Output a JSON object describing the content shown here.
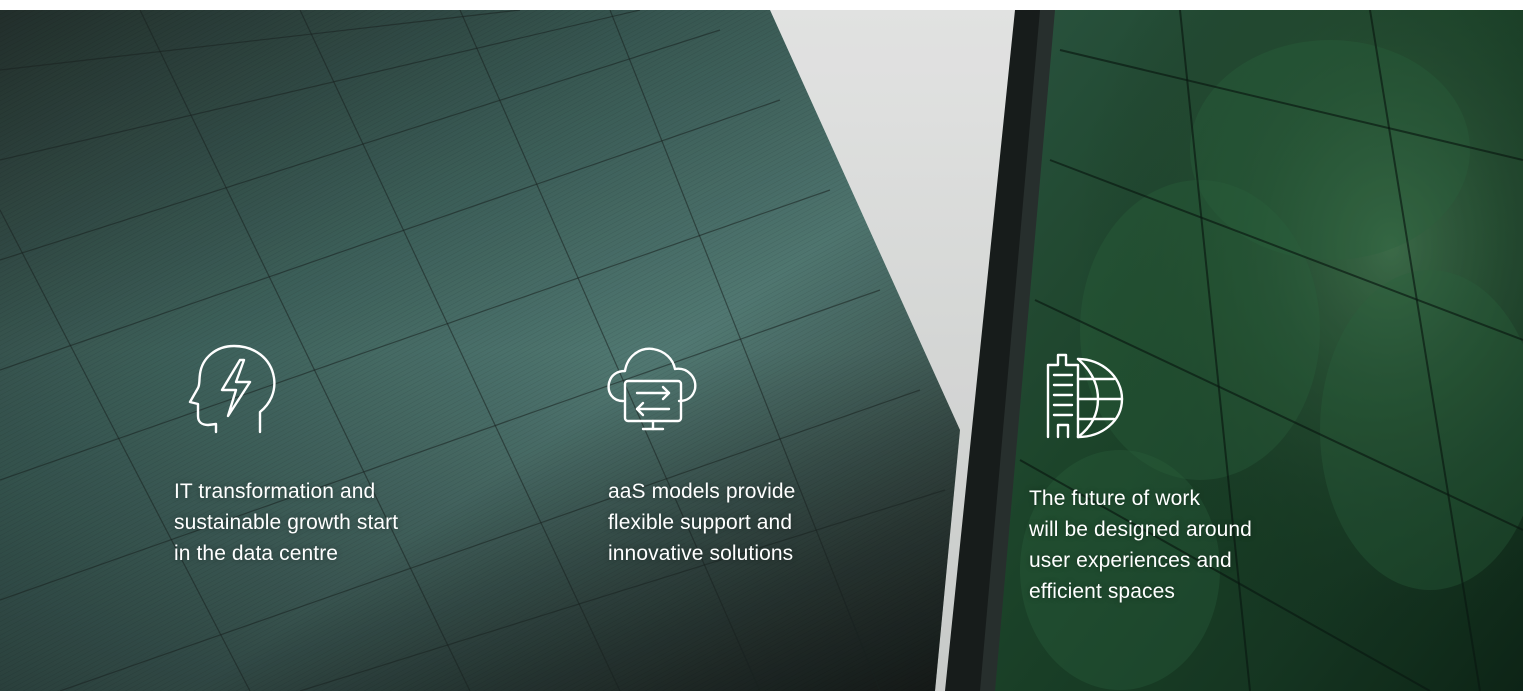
{
  "features": [
    {
      "icon": "head-lightning-icon",
      "lines": [
        "IT transformation and",
        "sustainable growth start",
        "in the data centre"
      ]
    },
    {
      "icon": "cloud-monitor-sync-icon",
      "lines": [
        "aaS models provide",
        "flexible support and",
        "innovative solutions"
      ]
    },
    {
      "icon": "building-globe-icon",
      "lines": [
        "The future of work",
        "will be designed around",
        "user experiences and",
        "efficient spaces"
      ]
    }
  ],
  "colors": {
    "text": "#ffffff",
    "glass_teal": "#3f6a63",
    "glass_dark": "#1d2826",
    "forest_green": "#1f4a2e",
    "sky": "#eef0ef"
  }
}
